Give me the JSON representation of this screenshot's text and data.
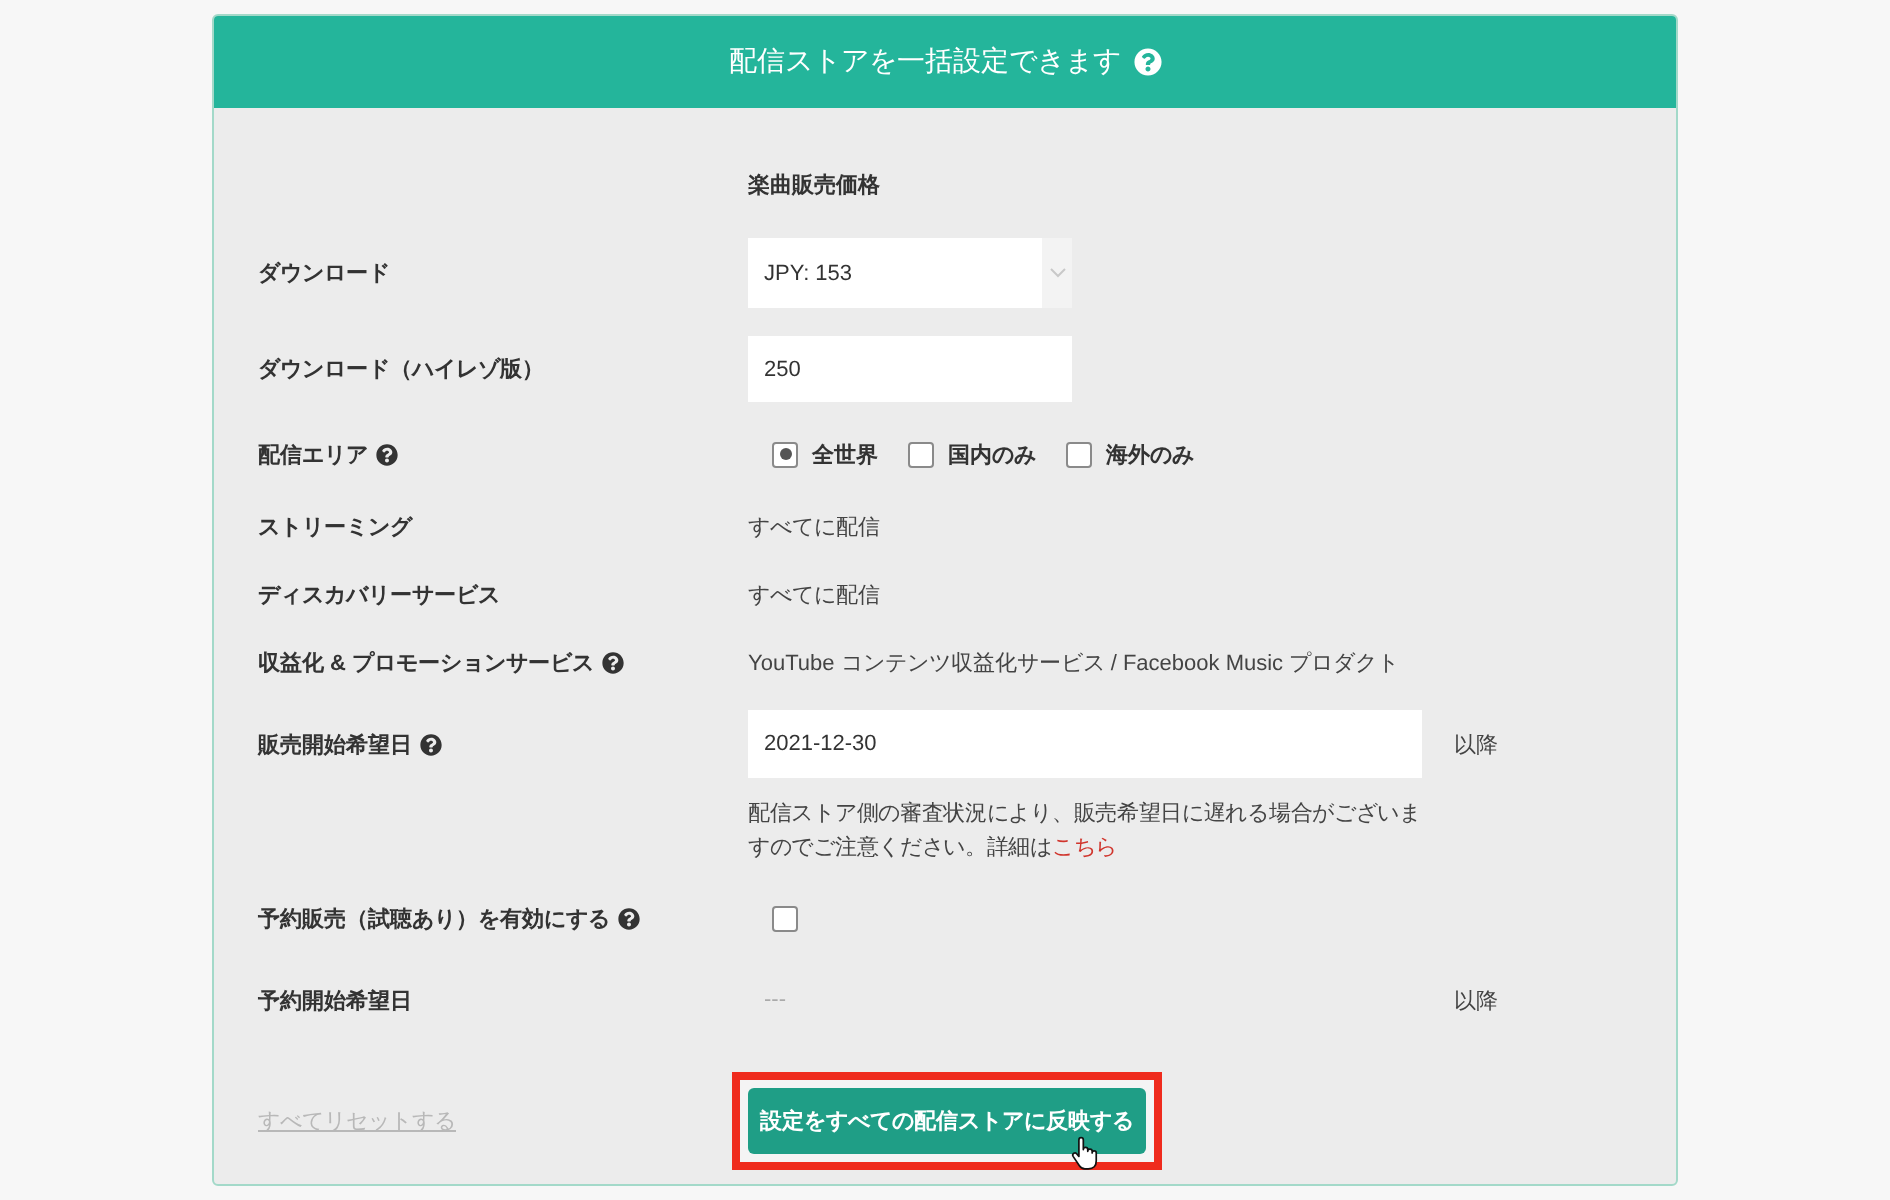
{
  "header": {
    "title": "配信ストアを一括設定できます",
    "help": true
  },
  "section_heading": "楽曲販売価格",
  "rows": [
    {
      "kind": "select",
      "label": "ダウンロード",
      "help": false,
      "value": "JPY: 153"
    },
    {
      "kind": "input",
      "label": "ダウンロード（ハイレゾ版）",
      "help": false,
      "value": "250"
    },
    {
      "kind": "choice",
      "label": "配信エリア",
      "help": true,
      "options": [
        {
          "label": "全世界",
          "selected": true
        },
        {
          "label": "国内のみ",
          "selected": false
        },
        {
          "label": "海外のみ",
          "selected": false
        }
      ]
    },
    {
      "kind": "text",
      "label": "ストリーミング",
      "help": false,
      "value": "すべてに配信"
    },
    {
      "kind": "text",
      "label": "ディスカバリーサービス",
      "help": false,
      "value": "すべてに配信"
    },
    {
      "kind": "text",
      "label": "収益化 & プロモーションサービス",
      "help": true,
      "value": "YouTube コンテンツ収益化サービス / Facebook Music プロダクト"
    },
    {
      "kind": "date",
      "label": "販売開始希望日",
      "help": true,
      "value": "2021-12-30",
      "disabled": false,
      "suffix": "以降",
      "note": "配信ストア側の審査状況により、販売希望日に遅れる場合がございますのでご注意ください。詳細は",
      "note_link": "こちら"
    },
    {
      "kind": "checkbox",
      "label": "予約販売（試聴あり）を有効にする",
      "help": true,
      "checked": false
    },
    {
      "kind": "date",
      "label": "予約開始希望日",
      "help": false,
      "value": "---",
      "disabled": true,
      "suffix": "以降"
    }
  ],
  "footer": {
    "reset_link": "すべてリセットする",
    "apply_button": "設定をすべての配信ストアに反映する",
    "highlighted": true
  }
}
